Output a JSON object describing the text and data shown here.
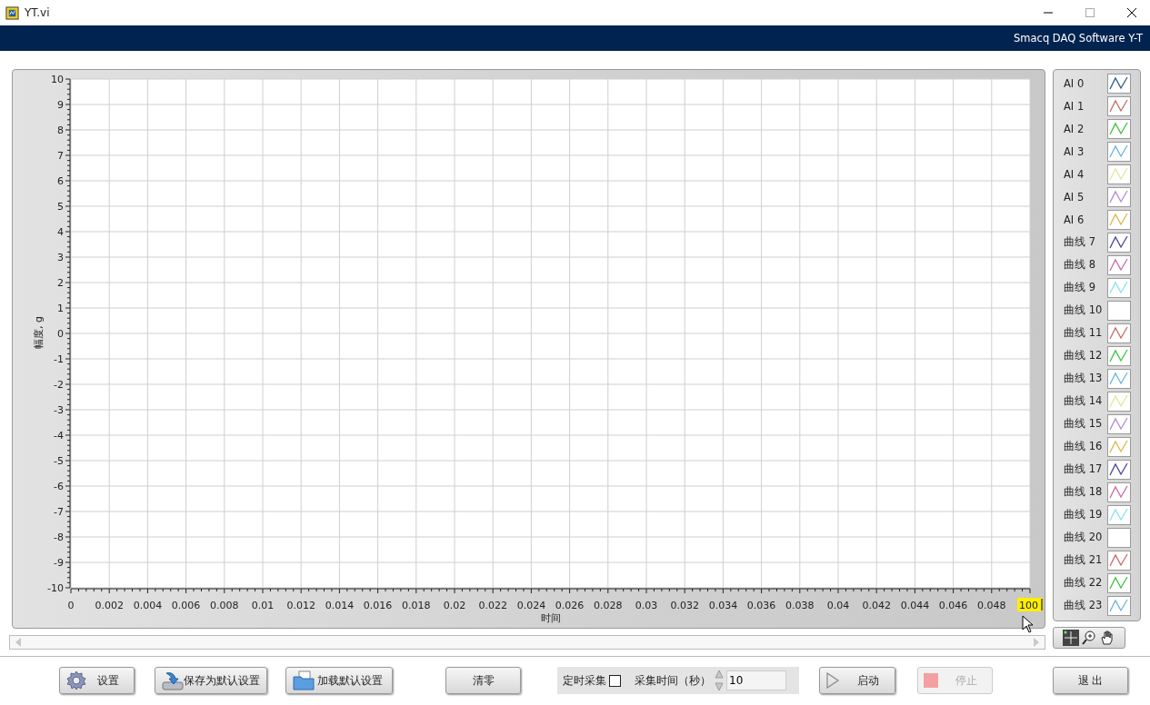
{
  "window": {
    "title": "YT.vi"
  },
  "banner": {
    "title": "Smacq DAQ Software Y-T"
  },
  "chart": {
    "x_max_input": {
      "value": "100"
    },
    "chart_data": {
      "type": "line",
      "grid": true,
      "xlabel": "时间",
      "ylabel": "幅度, g",
      "xlim": [
        0,
        0.05
      ],
      "ylim": [
        -10,
        10
      ],
      "xticks": [
        0,
        0.002,
        0.004,
        0.006,
        0.008,
        0.01,
        0.012,
        0.014,
        0.016,
        0.018,
        0.02,
        0.022,
        0.024,
        0.026,
        0.028,
        0.03,
        0.032,
        0.034,
        0.036,
        0.038,
        0.04,
        0.042,
        0.044,
        0.046,
        0.048
      ],
      "yticks": [
        10,
        9,
        8,
        7,
        6,
        5,
        4,
        3,
        2,
        1,
        0,
        -1,
        -2,
        -3,
        -4,
        -5,
        -6,
        -7,
        -8,
        -9,
        -10
      ]
    }
  },
  "legend": [
    {
      "name": "AI 0",
      "color": "#2a5a8a"
    },
    {
      "name": "AI 1",
      "color": "#c46a6a"
    },
    {
      "name": "AI 2",
      "color": "#3cc23c"
    },
    {
      "name": "AI 3",
      "color": "#6ab4de"
    },
    {
      "name": "AI 4",
      "color": "#e6e69a"
    },
    {
      "name": "AI 5",
      "color": "#b688d4"
    },
    {
      "name": "AI 6",
      "color": "#e0b448"
    },
    {
      "name": "曲线 7",
      "color": "#46469a"
    },
    {
      "name": "曲线 8",
      "color": "#c86aa6"
    },
    {
      "name": "曲线 9",
      "color": "#86e2f0"
    },
    {
      "name": "曲线 10",
      "color": "#ffffff"
    },
    {
      "name": "曲线 11",
      "color": "#c46a6a"
    },
    {
      "name": "曲线 12",
      "color": "#3cc23c"
    },
    {
      "name": "曲线 13",
      "color": "#6ab4de"
    },
    {
      "name": "曲线 14",
      "color": "#e6e69a"
    },
    {
      "name": "曲线 15",
      "color": "#b688d4"
    },
    {
      "name": "曲线 16",
      "color": "#e0b448"
    },
    {
      "name": "曲线 17",
      "color": "#46469a"
    },
    {
      "name": "曲线 18",
      "color": "#c86aa6"
    },
    {
      "name": "曲线 19",
      "color": "#86e2f0"
    },
    {
      "name": "曲线 20",
      "color": "#ffffff"
    },
    {
      "name": "曲线 21",
      "color": "#c46a6a"
    },
    {
      "name": "曲线 22",
      "color": "#3cc23c"
    },
    {
      "name": "曲线 23",
      "color": "#6ab4de"
    }
  ],
  "actions_left": [
    {
      "label": "设置",
      "disabled": false
    },
    {
      "label": "保存为默认设置",
      "disabled": false
    },
    {
      "label": "加载默认设置",
      "disabled": false
    },
    {
      "label": "清零",
      "disabled": false
    }
  ],
  "acquisition": {
    "timed": {
      "label": "定时采集",
      "checked": false
    },
    "duration": {
      "label": "采集时间（秒）",
      "value": "10"
    }
  },
  "actions_right": [
    {
      "label": "启动",
      "disabled": false
    },
    {
      "label": "停止",
      "disabled": true
    },
    {
      "label": "退 出",
      "disabled": false
    }
  ]
}
